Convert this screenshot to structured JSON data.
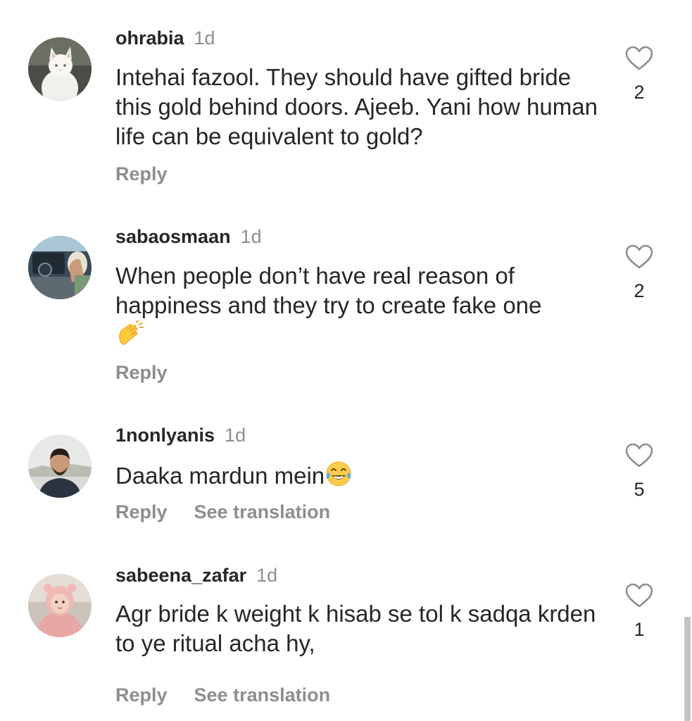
{
  "comments": [
    {
      "username": "ohrabia",
      "time": "1d",
      "text": "Intehai fazool. They should have gifted bride this gold behind doors. Ajeeb. Yani how human life can be equivalent to gold?",
      "reply_label": "Reply",
      "likes": "2"
    },
    {
      "username": "sabaosmaan",
      "time": "1d",
      "text": "When people don’t have real reason of happiness and they try to create fake one",
      "emoji": "clapping-hands-icon",
      "reply_label": "Reply",
      "likes": "2"
    },
    {
      "username": "1nonlyanis",
      "time": "1d",
      "text": "Daaka mardun mein",
      "emoji": "face-with-tears-of-joy-icon",
      "reply_label": "Reply",
      "translate_label": "See translation",
      "likes": "5"
    },
    {
      "username": "sabeena_zafar",
      "time": "1d",
      "text": "Agr bride k weight k hisab se tol k sadqa krden to ye ritual acha hy,",
      "reply_label": "Reply",
      "translate_label": "See translation",
      "likes": "1"
    }
  ],
  "icons": {
    "like": "heart-outline-icon"
  },
  "colors": {
    "text": "#262626",
    "secondary": "#8e8e8e",
    "background": "#ffffff"
  }
}
